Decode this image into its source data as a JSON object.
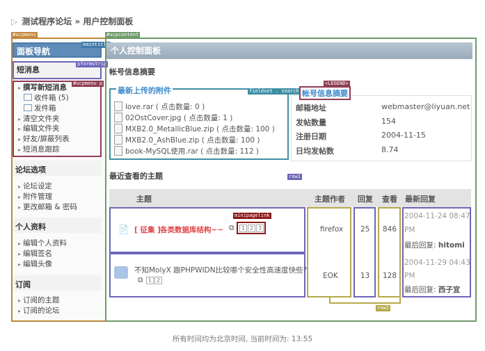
{
  "breadcrumb": {
    "site": "测试程序论坛",
    "sep": "»",
    "page": "用户控制面板"
  },
  "debug_tags": {
    "ucpmenu": "#ucpmenu",
    "ucpcontent": "#ucpcontent",
    "maintitle": "maintitle",
    "pformstrip": "pformstrip",
    "ucpmenu_p": "#ucpmenu p",
    "fieldset_search": "fieldset . search",
    "legend": "<LEGEND>",
    "row1": "row1",
    "row2": "row2",
    "minipagelink": "minipagelink"
  },
  "sidebar": {
    "title": "面板导航",
    "pm_title": "短消息",
    "pm_items": [
      "撰写新短消息",
      "收件箱 (5)",
      "发件箱",
      "清空文件夹",
      "编辑文件夹",
      "好友/屏蔽列表",
      "短消息跟踪"
    ],
    "forum_title": "论坛选项",
    "forum_items": [
      "论坛设定",
      "附件管理",
      "更改邮箱 & 密码"
    ],
    "profile_title": "个人资料",
    "profile_items": [
      "编辑个人资料",
      "编辑签名",
      "编辑头像"
    ],
    "sub_title": "订阅",
    "sub_items": [
      "订阅的主题",
      "订阅的论坛"
    ]
  },
  "content": {
    "title": "个人控制面板",
    "summary_title": "帐号信息摘要",
    "attachments_legend": "最新上传的附件",
    "attachments": [
      "love.rar ( 点击数量: 0 )",
      "02OstCover.jpg ( 点击数量: 1 )",
      "MXB2.0_MetallicBlue.zip ( 点击数量: 100 )",
      "MXB2.0_AshBlue.zip ( 点击数量: 100 )",
      "book-MySQL使用.rar ( 点击数量: 112 )"
    ],
    "account_legend": "帐号信息摘要",
    "account": [
      {
        "k": "邮箱地址",
        "v": "webmaster@liyuan.net"
      },
      {
        "k": "发帖数量",
        "v": "154"
      },
      {
        "k": "注册日期",
        "v": "2004-11-15"
      },
      {
        "k": "日均发帖数",
        "v": "8.74"
      }
    ],
    "recent_title": "最近查看的主题",
    "table_headers": {
      "topic": "主题",
      "author": "主题作者",
      "replies": "回复",
      "views": "查看",
      "last": "最新回复"
    },
    "rows": [
      {
        "prefix": "[ 征集 ]",
        "topic": "各类数据库结构~~",
        "pages": [
          "1",
          "2",
          "3"
        ],
        "author": "firefox",
        "replies": "25",
        "views": "846",
        "last_date": "2004-11-24 08:47",
        "last_ampm": "PM",
        "last_label": "最后回复:",
        "last_user": "hitomi"
      },
      {
        "prefix": "",
        "topic": "不知MolyX 跟PHPWIDN比较哪个安全性高速度快些?",
        "pages": [
          "1",
          "2"
        ],
        "author": "EOK",
        "replies": "13",
        "views": "128",
        "last_date": "2004-11-29 04:43",
        "last_ampm": "PM",
        "last_label": "最后回复:",
        "last_user": "西子宜"
      }
    ]
  },
  "footer": "所有时间均为北京时间, 当前时间为: 13:55"
}
